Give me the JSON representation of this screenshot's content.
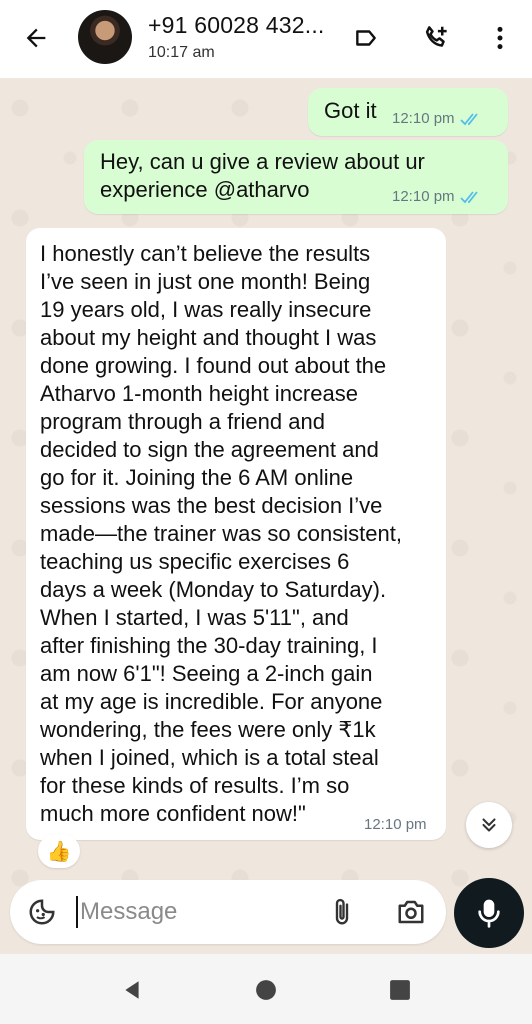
{
  "header": {
    "contact_name": "+91 60028 432...",
    "last_seen": "10:17 am",
    "icons": [
      "back-arrow-icon",
      "label-icon",
      "add-call-icon",
      "more-vertical-icon"
    ]
  },
  "messages": [
    {
      "direction": "out",
      "text": "Got it",
      "time": "12:10 pm",
      "status": "read"
    },
    {
      "direction": "out",
      "text": "Hey, can u give a review about ur\nexperience @atharvo",
      "time": "12:10 pm",
      "status": "read"
    },
    {
      "direction": "in",
      "text": "I honestly can’t believe the results\nI’ve seen in just one month! Being\n19 years old, I was really insecure\nabout my height and thought I was\ndone growing. I found out about the\nAtharvo 1-month height increase\nprogram through a friend and\ndecided to sign the agreement and\ngo for it. Joining the 6 AM online\nsessions was the best decision I’ve\nmade—the trainer was so consistent,\nteaching us specific exercises 6\ndays a week (Monday to Saturday).\nWhen I started, I was 5'11\", and\nafter finishing the 30-day training, I\nam now 6'1\"! Seeing a 2-inch gain\nat my age is incredible. For anyone\nwondering, the fees were only ₹1k\nwhen I joined, which is a total steal\nfor these kinds of results. I’m so\nmuch more confident now!\"",
      "time": "12:10 pm",
      "reaction": "👍"
    }
  ],
  "composer": {
    "placeholder": "Message"
  },
  "colors": {
    "outgoing_bubble": "#d9fdd3",
    "incoming_bubble": "#ffffff",
    "chat_background": "#efe7de",
    "read_ticks": "#53bdeb",
    "mic_button": "#111a1e"
  }
}
